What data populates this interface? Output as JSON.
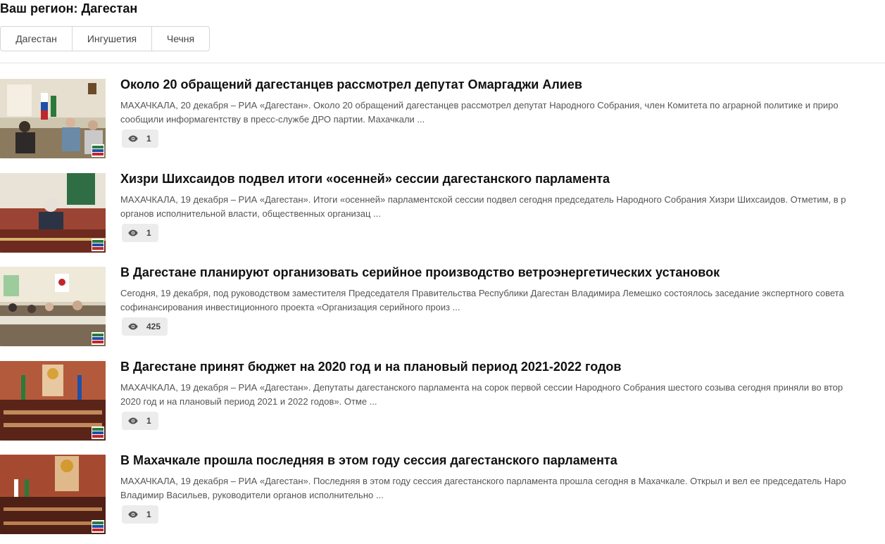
{
  "region": {
    "title": "Ваш регион: Дагестан"
  },
  "tabs": [
    {
      "label": "Дагестан"
    },
    {
      "label": "Ингушетия"
    },
    {
      "label": "Чечня"
    }
  ],
  "news": [
    {
      "title": "Около 20 обращений дагестанцев рассмотрел депутат Омаргаджи Алиев",
      "text_line1": "МАХАЧКАЛА, 20 декабря – РИА «Дагестан». Около 20 обращений дагестанцев рассмотрел депутат Народного Собрания, член Комитета по аграрной политике и приро",
      "text_line2": "сообщили информагентству в пресс-службе ДРО партии. Махачкали ...",
      "views": "1"
    },
    {
      "title": "Хизри Шихсаидов подвел итоги «осенней» сессии дагестанского парламента",
      "text_line1": "МАХАЧКАЛА, 19 декабря – РИА «Дагестан». Итоги «осенней» парламентской сессии подвел сегодня председатель Народного Собрания Хизри Шихсаидов. Отметим, в р",
      "text_line2": "органов исполнительной власти, общественных организац ...",
      "views": "1"
    },
    {
      "title": "В Дагестане планируют организовать серийное производство ветроэнергетических установок",
      "text_line1": "Сегодня, 19 декабря, под руководством заместителя Председателя Правительства Республики Дагестан Владимира Лемешко состоялось заседание экспертного совета",
      "text_line2": "софинансирования инвестиционного проекта «Организация серийного произ ...",
      "views": "425"
    },
    {
      "title": "В Дагестане принят бюджет на 2020 год и на плановый период 2021-2022 годов",
      "text_line1": "МАХАЧКАЛА, 19 декабря – РИА «Дагестан». Депутаты дагестанского парламента на сорок первой сессии Народного Собрания шестого созыва сегодня приняли во втор",
      "text_line2": "2020 год и на плановый период 2021 и 2022 годов». Отме ...",
      "views": "1"
    },
    {
      "title": "В Махачкале прошла последняя в этом году сессия дагестанского парламента",
      "text_line1": "МАХАЧКАЛА, 19 декабря – РИА «Дагестан». Последняя в этом году сессия дагестанского парламента прошла сегодня в Махачкале. Открыл и вел ее председатель Наро",
      "text_line2": "Владимир Васильев, руководители органов исполнительно ...",
      "views": "1"
    }
  ]
}
